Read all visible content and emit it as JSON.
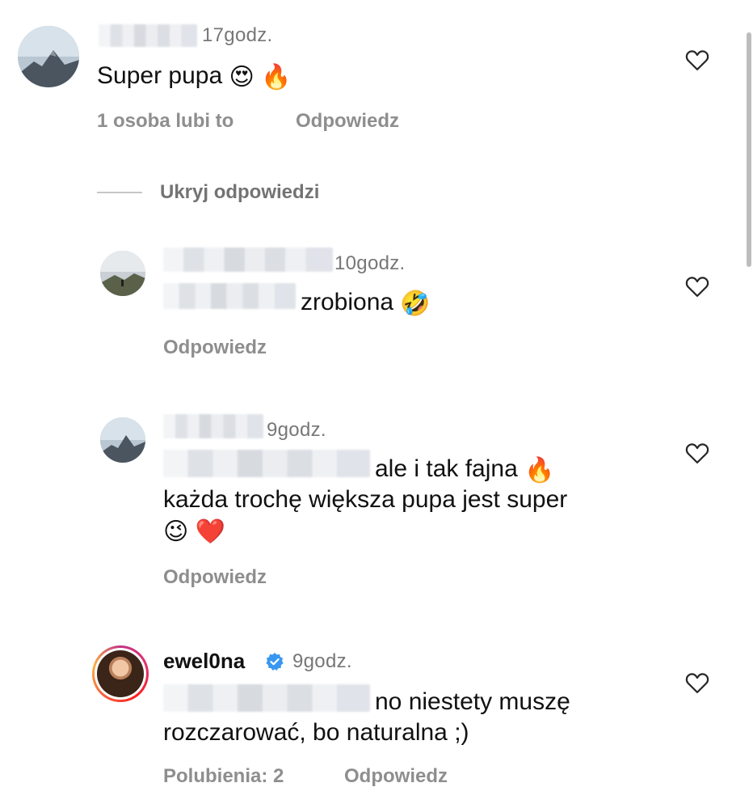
{
  "comments": [
    {
      "time": "17godz.",
      "text": "Super pupa",
      "emojis": [
        "😍",
        "🔥"
      ],
      "likes_label": "1 osoba lubi to",
      "reply_label": "Odpowiedz"
    }
  ],
  "replies_toggle": "Ukryj odpowiedzi",
  "replies": [
    {
      "time": "10godz.",
      "text": "zrobiona",
      "emojis": [
        "🤣"
      ],
      "reply_label": "Odpowiedz"
    },
    {
      "time": "9godz.",
      "text_line1": "ale i tak fajna",
      "text_line1_emoji": "🔥",
      "text_line2": "każda trochę większa pupa jest super",
      "emojis_line3": [
        "😉",
        "❤️"
      ],
      "reply_label": "Odpowiedz"
    },
    {
      "username": "ewel0na",
      "time": "9godz.",
      "text_line1": "no niestety muszę",
      "text_line2": "rozczarować, bo naturalna ;)",
      "likes_label": "Polubienia: 2",
      "reply_label": "Odpowiedz"
    }
  ],
  "colors": {
    "verified": "#3897f0",
    "meta_text": "#8e8e8e",
    "time_text": "#777777"
  },
  "icons": [
    "heart-outline-icon",
    "verified-badge-icon"
  ]
}
